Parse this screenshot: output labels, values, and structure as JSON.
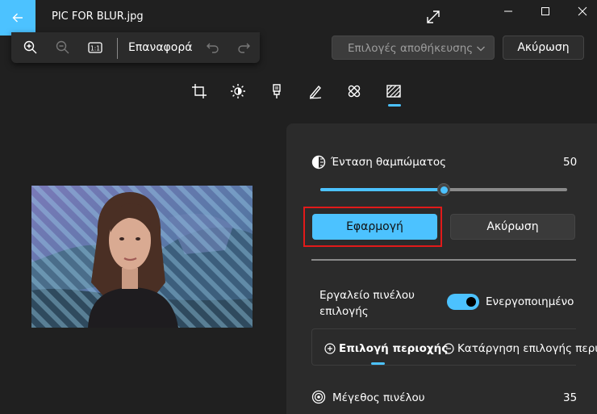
{
  "window": {
    "title": "PIC FOR BLUR.jpg"
  },
  "toolbar": {
    "reset_label": "Επαναφορά",
    "icons": [
      "zoom-in-icon",
      "zoom-out-icon",
      "actual-size-icon",
      "undo-icon",
      "redo-icon"
    ]
  },
  "header": {
    "save_options_label": "Επιλογές αποθήκευσης",
    "cancel_label": "Ακύρωση"
  },
  "tools": [
    "crop-icon",
    "adjust-brightness-icon",
    "markup-icon",
    "draw-icon",
    "retouch-icon",
    "blur-background-icon"
  ],
  "panel": {
    "blur_intensity_label": "Ένταση θαμπώματος",
    "blur_intensity_value": "50",
    "blur_intensity_fraction": 0.5,
    "apply_label": "Εφαρμογή",
    "cancel_label": "Ακύρωση",
    "brush_tool_label": "Εργαλείο πινέλου επιλογής",
    "toggle_state_label": "Ενεργοποιημένο",
    "select_area_label": "Επιλογή περιοχής",
    "deselect_area_label": "Κατάργηση επιλογής περιοχής",
    "brush_size_label": "Μέγεθος πινέλου",
    "brush_size_value": "35"
  },
  "colors": {
    "accent": "#4cc2ff",
    "background": "#202020",
    "panel": "#2b2b2b",
    "highlight_outline": "#e11a1a"
  }
}
